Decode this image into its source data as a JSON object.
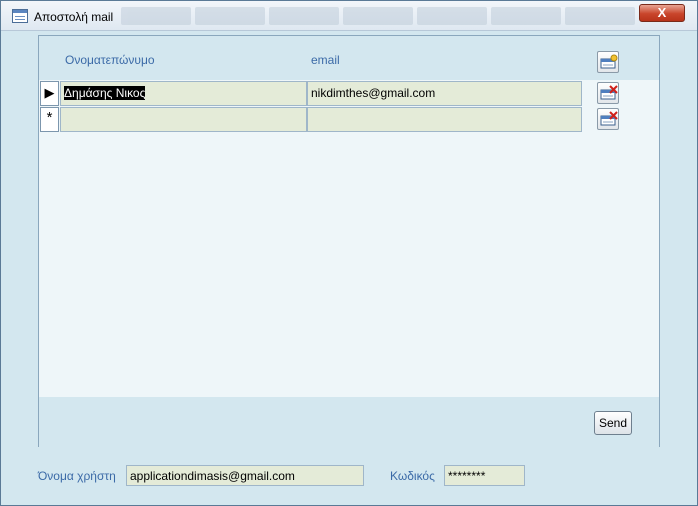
{
  "window": {
    "title": "Αποστολή mail",
    "close_glyph": "X"
  },
  "grid": {
    "headers": [
      "Ονοματεπώνυμο",
      "email"
    ],
    "rows": [
      {
        "selector_glyph": "▶",
        "name": "Δημάσης Νικος",
        "email": "nikdimthes@gmail.com"
      },
      {
        "selector_glyph": "*",
        "name": "",
        "email": ""
      }
    ],
    "add_icon": "add-record-icon",
    "delete_icon": "delete-record-icon"
  },
  "actions": {
    "send_label": "Send"
  },
  "credentials": {
    "username_label": "Όνομα χρήστη",
    "username_value": "applicationdimasis@gmail.com",
    "password_label": "Κωδικός",
    "password_value": "********"
  },
  "colors": {
    "accent_text": "#3b6aa7",
    "field_bg": "#e4ebd8",
    "form_bg": "#d3e7ef",
    "close_red": "#c9452b"
  }
}
